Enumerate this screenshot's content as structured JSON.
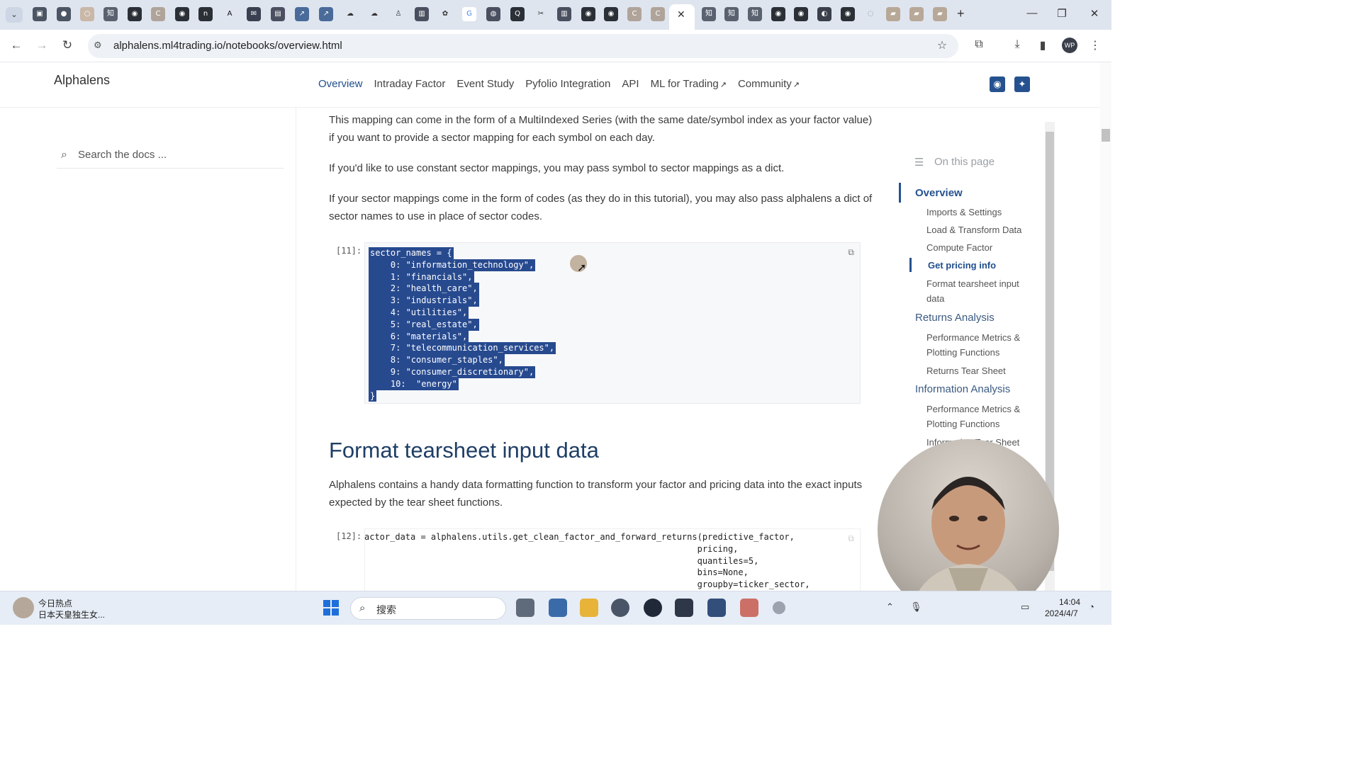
{
  "browser": {
    "url": "alphalens.ml4trading.io/notebooks/overview.html",
    "tab_icons": [
      "知",
      "知",
      "知"
    ],
    "profile_initials": "WP"
  },
  "header": {
    "brand": "Alphalens",
    "nav": [
      {
        "label": "Overview",
        "active": true
      },
      {
        "label": "Intraday Factor"
      },
      {
        "label": "Event Study"
      },
      {
        "label": "Pyfolio Integration"
      },
      {
        "label": "API"
      },
      {
        "label": "ML for Trading",
        "external": true
      },
      {
        "label": "Community",
        "external": true
      }
    ]
  },
  "sidebar": {
    "search_placeholder": "Search the docs ..."
  },
  "content": {
    "para1": "This mapping can come in the form of a MultiIndexed Series (with the same date/symbol index as your factor value) if you want to provide a sector mapping for each symbol on each day.",
    "para2": "If you'd like to use constant sector mappings, you may pass symbol to sector mappings as a dict.",
    "para3": "If your sector mappings come in the form of codes (as they do in this tutorial), you may also pass alphalens a dict of sector names to use in place of sector codes.",
    "cell1_prompt": "[11]:",
    "cell1_lines": [
      "sector_names = {",
      "    0: \"information_technology\",",
      "    1: \"financials\",",
      "    2: \"health_care\",",
      "    3: \"industrials\",",
      "    4: \"utilities\",",
      "    5: \"real_estate\",",
      "    6: \"materials\",",
      "    7: \"telecommunication_services\",",
      "    8: \"consumer_staples\",",
      "    9: \"consumer_discretionary\",",
      "    10:  \"energy\"",
      "}"
    ],
    "section_title": "Format tearsheet input data",
    "para4": "Alphalens contains a handy data formatting function to transform your factor and pricing data into the exact inputs expected by the tear sheet functions.",
    "cell2_prompt": "[12]:",
    "cell2_lines": [
      "actor_data = alphalens.utils.get_clean_factor_and_forward_returns(predictive_factor,",
      "                                                                 pricing,",
      "                                                                 quantiles=5,",
      "                                                                 bins=None,",
      "                                                                 groupby=ticker_sector,"
    ]
  },
  "toc": {
    "heading": "On this page",
    "items": [
      {
        "label": "Overview",
        "level": 1
      },
      {
        "label": "Imports & Settings",
        "level": 2
      },
      {
        "label": "Load & Transform Data",
        "level": 2
      },
      {
        "label": "Compute Factor",
        "level": 2
      },
      {
        "label": "Get pricing info",
        "level": 2,
        "active": true
      },
      {
        "label": "Format tearsheet input data",
        "level": 2
      },
      {
        "label": "Returns Analysis",
        "level": 1
      },
      {
        "label": "Performance Metrics & Plotting Functions",
        "level": 2
      },
      {
        "label": "Returns Tear Sheet",
        "level": 2
      },
      {
        "label": "Information Analysis",
        "level": 1
      },
      {
        "label": "Performance Metrics & Plotting Functions",
        "level": 2
      },
      {
        "label": "Information Tear Sheet",
        "level": 2
      }
    ]
  },
  "taskbar": {
    "news_title": "今日热点",
    "news_sub": "日本天皇独生女...",
    "search_label": "搜索",
    "time": "14:04",
    "date": "2024/4/7"
  },
  "colors": {
    "accent": "#25528f",
    "selection": "#274a8f",
    "heading": "#1f3e66"
  }
}
